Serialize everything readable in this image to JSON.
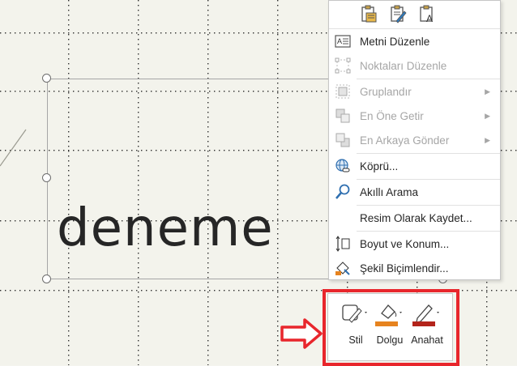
{
  "slide": {
    "text": "deneme"
  },
  "context_menu": {
    "top_icons": [
      "paste-keep-formatting-icon",
      "paste-picture-icon",
      "paste-text-only-icon"
    ],
    "items": [
      {
        "label": "Metni Düzenle",
        "icon": "edit-text-icon",
        "enabled": true,
        "submenu": false
      },
      {
        "label": "Noktaları Düzenle",
        "icon": "edit-points-icon",
        "enabled": false,
        "submenu": false
      },
      {
        "label": "Gruplandır",
        "icon": "group-icon",
        "enabled": false,
        "submenu": true
      },
      {
        "label": "En Öne Getir",
        "icon": "bring-to-front-icon",
        "enabled": false,
        "submenu": true
      },
      {
        "label": "En Arkaya Gönder",
        "icon": "send-to-back-icon",
        "enabled": false,
        "submenu": true
      },
      {
        "label": "Köprü...",
        "icon": "hyperlink-icon",
        "enabled": true,
        "submenu": false
      },
      {
        "label": "Akıllı Arama",
        "icon": "smart-lookup-icon",
        "enabled": true,
        "submenu": false
      },
      {
        "label": "Resim Olarak Kaydet...",
        "icon": "",
        "enabled": true,
        "submenu": false
      },
      {
        "label": "Boyut ve Konum...",
        "icon": "size-position-icon",
        "enabled": true,
        "submenu": false
      },
      {
        "label": "Şekil Biçimlendir...",
        "icon": "format-shape-icon",
        "enabled": true,
        "submenu": false
      }
    ]
  },
  "mini_toolbar": {
    "buttons": [
      {
        "label": "Stil",
        "icon": "style-icon"
      },
      {
        "label": "Dolgu",
        "icon": "fill-bucket-icon",
        "color": "#e6831f"
      },
      {
        "label": "Anahat",
        "icon": "outline-pen-icon",
        "color": "#b3241b"
      }
    ]
  },
  "colors": {
    "highlight": "#e8262c",
    "disabled_text": "#a6a6a6"
  }
}
